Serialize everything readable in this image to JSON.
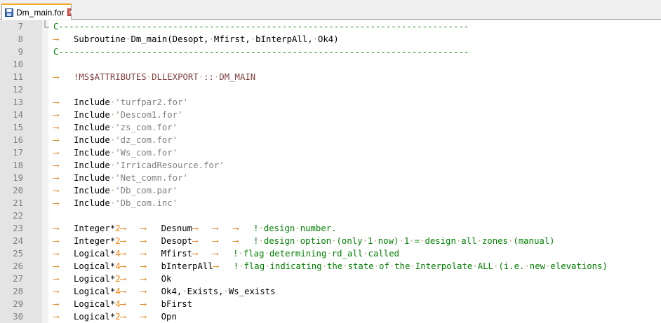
{
  "tab": {
    "title": "Dm_main.for",
    "icon": "save-icon"
  },
  "lines": [
    {
      "n": "7",
      "segs": [
        [
          "cmt",
          "C-------------------------------------------------------------------------------"
        ]
      ]
    },
    {
      "n": "8",
      "segs": [
        [
          "arrow",
          "⟶"
        ],
        [
          "txt",
          "Subroutine"
        ],
        [
          "dot",
          "·"
        ],
        [
          "txt",
          "Dm_main(Desopt,"
        ],
        [
          "dot",
          "·"
        ],
        [
          "txt",
          "Mfirst,"
        ],
        [
          "dot",
          "·"
        ],
        [
          "txt",
          "bInterpAll,"
        ],
        [
          "dot",
          "·"
        ],
        [
          "txt",
          "Ok4)"
        ]
      ]
    },
    {
      "n": "9",
      "segs": [
        [
          "cmt",
          "C-------------------------------------------------------------------------------"
        ]
      ]
    },
    {
      "n": "10",
      "segs": []
    },
    {
      "n": "11",
      "segs": [
        [
          "arrow",
          "⟶"
        ],
        [
          "dir",
          "!MS$ATTRIBUTES"
        ],
        [
          "dot",
          "·"
        ],
        [
          "dir",
          "DLLEXPORT"
        ],
        [
          "dot",
          "·"
        ],
        [
          "dir",
          "::"
        ],
        [
          "dot",
          "·"
        ],
        [
          "dir",
          "DM_MAIN"
        ]
      ]
    },
    {
      "n": "12",
      "segs": []
    },
    {
      "n": "13",
      "segs": [
        [
          "arrow",
          "⟶"
        ],
        [
          "txt",
          "Include"
        ],
        [
          "dot",
          "·"
        ],
        [
          "str",
          "'turfpar2.for'"
        ]
      ]
    },
    {
      "n": "14",
      "segs": [
        [
          "arrow",
          "⟶"
        ],
        [
          "txt",
          "Include"
        ],
        [
          "dot",
          "·"
        ],
        [
          "str",
          "'Descom1.for'"
        ]
      ]
    },
    {
      "n": "15",
      "segs": [
        [
          "arrow",
          "⟶"
        ],
        [
          "txt",
          "Include"
        ],
        [
          "dot",
          "·"
        ],
        [
          "str",
          "'zs_com.for'"
        ]
      ]
    },
    {
      "n": "16",
      "segs": [
        [
          "arrow",
          "⟶"
        ],
        [
          "txt",
          "Include"
        ],
        [
          "dot",
          "·"
        ],
        [
          "str",
          "'dz_com.for'"
        ]
      ]
    },
    {
      "n": "17",
      "segs": [
        [
          "arrow",
          "⟶"
        ],
        [
          "txt",
          "Include"
        ],
        [
          "dot",
          "·"
        ],
        [
          "str",
          "'Ws_com.for'"
        ]
      ]
    },
    {
      "n": "18",
      "segs": [
        [
          "arrow",
          "⟶"
        ],
        [
          "txt",
          "Include"
        ],
        [
          "dot",
          "·"
        ],
        [
          "str",
          "'IrricadResource.for'"
        ]
      ]
    },
    {
      "n": "19",
      "segs": [
        [
          "arrow",
          "⟶"
        ],
        [
          "txt",
          "Include"
        ],
        [
          "dot",
          "·"
        ],
        [
          "str",
          "'Net_comn.for'"
        ]
      ]
    },
    {
      "n": "20",
      "segs": [
        [
          "arrow",
          "⟶"
        ],
        [
          "txt",
          "Include"
        ],
        [
          "dot",
          "·"
        ],
        [
          "str",
          "'Db_com.par'"
        ]
      ]
    },
    {
      "n": "21",
      "segs": [
        [
          "arrow",
          "⟶"
        ],
        [
          "txt",
          "Include"
        ],
        [
          "dot",
          "·"
        ],
        [
          "str",
          "'Db_com.inc'"
        ]
      ]
    },
    {
      "n": "22",
      "segs": []
    },
    {
      "n": "23",
      "segs": [
        [
          "arrow",
          "⟶"
        ],
        [
          "txt",
          "Integer*"
        ],
        [
          "num",
          "2"
        ],
        [
          "arrow",
          "⟶"
        ],
        [
          "arrow",
          "⟶"
        ],
        [
          "txt",
          "Desnum"
        ],
        [
          "arrow",
          "⟶"
        ],
        [
          "arrow",
          "⟶"
        ],
        [
          "arrow",
          "⟶"
        ],
        [
          "cmt",
          "!"
        ],
        [
          "dot",
          "·"
        ],
        [
          "cmt",
          "design"
        ],
        [
          "dot",
          "·"
        ],
        [
          "cmt",
          "number."
        ]
      ]
    },
    {
      "n": "24",
      "segs": [
        [
          "arrow",
          "⟶"
        ],
        [
          "txt",
          "Integer*"
        ],
        [
          "num",
          "2"
        ],
        [
          "arrow",
          "⟶"
        ],
        [
          "arrow",
          "⟶"
        ],
        [
          "txt",
          "Desopt"
        ],
        [
          "arrow",
          "⟶"
        ],
        [
          "arrow",
          "⟶"
        ],
        [
          "arrow",
          "⟶"
        ],
        [
          "cmt",
          "!"
        ],
        [
          "dot",
          "·"
        ],
        [
          "cmt",
          "design"
        ],
        [
          "dot",
          "·"
        ],
        [
          "cmt",
          "option"
        ],
        [
          "dot",
          "·"
        ],
        [
          "cmt",
          "(only"
        ],
        [
          "dot",
          "·"
        ],
        [
          "cmt",
          "1"
        ],
        [
          "dot",
          "·"
        ],
        [
          "cmt",
          "now)"
        ],
        [
          "dot",
          "·"
        ],
        [
          "cmt",
          "1"
        ],
        [
          "dot",
          "·"
        ],
        [
          "cmt",
          "="
        ],
        [
          "dot",
          "·"
        ],
        [
          "cmt",
          "design"
        ],
        [
          "dot",
          "·"
        ],
        [
          "cmt",
          "all"
        ],
        [
          "dot",
          "·"
        ],
        [
          "cmt",
          "zones"
        ],
        [
          "dot",
          "·"
        ],
        [
          "cmt",
          "(manual)"
        ]
      ]
    },
    {
      "n": "25",
      "segs": [
        [
          "arrow",
          "⟶"
        ],
        [
          "txt",
          "Logical*"
        ],
        [
          "num",
          "4"
        ],
        [
          "arrow",
          "⟶"
        ],
        [
          "arrow",
          "⟶"
        ],
        [
          "txt",
          "Mfirst"
        ],
        [
          "arrow",
          "⟶"
        ],
        [
          "arrow",
          "⟶"
        ],
        [
          "cmt",
          "!"
        ],
        [
          "dot",
          "·"
        ],
        [
          "cmt",
          "flag"
        ],
        [
          "dot",
          "·"
        ],
        [
          "cmt",
          "determining"
        ],
        [
          "dot",
          "·"
        ],
        [
          "cmt",
          "rd_all"
        ],
        [
          "dot",
          "·"
        ],
        [
          "cmt",
          "called"
        ]
      ]
    },
    {
      "n": "26",
      "segs": [
        [
          "arrow",
          "⟶"
        ],
        [
          "txt",
          "Logical*"
        ],
        [
          "num",
          "4"
        ],
        [
          "arrow",
          "⟶"
        ],
        [
          "arrow",
          "⟶"
        ],
        [
          "txt",
          "bInterpAll"
        ],
        [
          "arrow",
          "⟶"
        ],
        [
          "cmt",
          "!"
        ],
        [
          "dot",
          "·"
        ],
        [
          "cmt",
          "flag"
        ],
        [
          "dot",
          "·"
        ],
        [
          "cmt",
          "indicating"
        ],
        [
          "dot",
          "·"
        ],
        [
          "cmt",
          "the"
        ],
        [
          "dot",
          "·"
        ],
        [
          "cmt",
          "state"
        ],
        [
          "dot",
          "·"
        ],
        [
          "cmt",
          "of"
        ],
        [
          "dot",
          "·"
        ],
        [
          "cmt",
          "the"
        ],
        [
          "dot",
          "·"
        ],
        [
          "cmt",
          "Interpolate"
        ],
        [
          "dot",
          "·"
        ],
        [
          "cmt",
          "ALL"
        ],
        [
          "dot",
          "·"
        ],
        [
          "cmt",
          "(i.e."
        ],
        [
          "dot",
          "·"
        ],
        [
          "cmt",
          "new"
        ],
        [
          "dot",
          "·"
        ],
        [
          "cmt",
          "elevations)"
        ]
      ]
    },
    {
      "n": "27",
      "segs": [
        [
          "arrow",
          "⟶"
        ],
        [
          "txt",
          "Logical*"
        ],
        [
          "num",
          "2"
        ],
        [
          "arrow",
          "⟶"
        ],
        [
          "arrow",
          "⟶"
        ],
        [
          "txt",
          "Ok"
        ]
      ]
    },
    {
      "n": "28",
      "segs": [
        [
          "arrow",
          "⟶"
        ],
        [
          "txt",
          "Logical*"
        ],
        [
          "num",
          "4"
        ],
        [
          "arrow",
          "⟶"
        ],
        [
          "arrow",
          "⟶"
        ],
        [
          "txt",
          "Ok4,"
        ],
        [
          "dot",
          "·"
        ],
        [
          "txt",
          "Exists,"
        ],
        [
          "dot",
          "·"
        ],
        [
          "txt",
          "Ws_exists"
        ]
      ]
    },
    {
      "n": "29",
      "segs": [
        [
          "arrow",
          "⟶"
        ],
        [
          "txt",
          "Logical*"
        ],
        [
          "num",
          "4"
        ],
        [
          "arrow",
          "⟶"
        ],
        [
          "arrow",
          "⟶"
        ],
        [
          "txt",
          "bFirst"
        ]
      ]
    },
    {
      "n": "30",
      "segs": [
        [
          "arrow",
          "⟶"
        ],
        [
          "txt",
          "Logical*"
        ],
        [
          "num",
          "2"
        ],
        [
          "arrow",
          "⟶"
        ],
        [
          "arrow",
          "⟶"
        ],
        [
          "txt",
          "Opn"
        ]
      ]
    }
  ]
}
